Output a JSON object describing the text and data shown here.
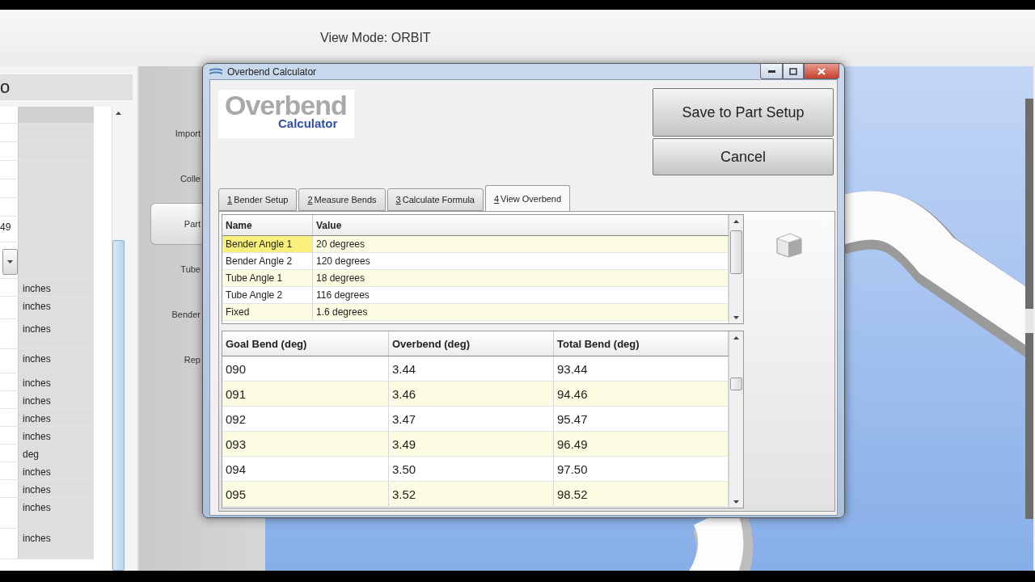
{
  "toolbar": {
    "view_mode": "View Mode: ORBIT"
  },
  "left_panel": {
    "title": "o",
    "rows": [
      {
        "kind": "text"
      },
      {
        "kind": "text"
      },
      {
        "kind": "text"
      },
      {
        "kind": "text"
      },
      {
        "kind": "text"
      },
      {
        "kind": "text",
        "value": "49"
      },
      {
        "kind": "dropdown"
      },
      {
        "kind": "text",
        "unit": "inches"
      },
      {
        "kind": "text",
        "unit": "inches"
      },
      {
        "kind": "text",
        "unit": "inches"
      },
      {
        "kind": "text",
        "unit": "inches"
      },
      {
        "kind": "text",
        "unit": "inches"
      },
      {
        "kind": "text",
        "unit": "inches"
      },
      {
        "kind": "text",
        "unit": "inches"
      },
      {
        "kind": "text",
        "unit": "inches"
      },
      {
        "kind": "text",
        "unit": "deg"
      },
      {
        "kind": "text",
        "unit": "inches"
      },
      {
        "kind": "text",
        "unit": "inches"
      },
      {
        "kind": "text",
        "unit": "inches"
      },
      {
        "kind": "text",
        "unit": "inches"
      }
    ]
  },
  "nav": [
    {
      "label": "Import",
      "selected": false
    },
    {
      "label": "Colle",
      "selected": false
    },
    {
      "label": "Part",
      "selected": true
    },
    {
      "label": "Tube",
      "selected": false
    },
    {
      "label": "Bender",
      "selected": false
    },
    {
      "label": "Rep",
      "selected": false
    }
  ],
  "dialog": {
    "title": "Overbend Calculator",
    "logo": {
      "title": "Overbend",
      "subtitle": "Calculator"
    },
    "buttons": [
      "Save to Part Setup",
      "Cancel"
    ],
    "tabs": [
      {
        "key": "1",
        "label": "Bender Setup",
        "selected": false
      },
      {
        "key": "2",
        "label": "Measure Bends",
        "selected": false
      },
      {
        "key": "3",
        "label": "Calculate Formula",
        "selected": false
      },
      {
        "key": "4",
        "label": "View Overbend",
        "selected": true
      }
    ],
    "settings_table": {
      "columns": [
        "Name",
        "Value"
      ],
      "rows": [
        {
          "name": "Bender Angle 1",
          "value": "20 degrees",
          "selected": true
        },
        {
          "name": "Bender Angle 2",
          "value": "120 degrees",
          "selected": false
        },
        {
          "name": "Tube Angle 1",
          "value": "18 degrees",
          "selected": false
        },
        {
          "name": "Tube Angle 2",
          "value": "116 degrees",
          "selected": false
        },
        {
          "name": "Fixed",
          "value": "1.6 degrees",
          "selected": false
        }
      ]
    },
    "overbend_table": {
      "columns": [
        "Goal Bend (deg)",
        "Overbend (deg)",
        "Total Bend (deg)"
      ],
      "rows": [
        [
          "090",
          "3.44",
          "93.44"
        ],
        [
          "091",
          "3.46",
          "94.46"
        ],
        [
          "092",
          "3.47",
          "95.47"
        ],
        [
          "093",
          "3.49",
          "96.49"
        ],
        [
          "094",
          "3.50",
          "97.50"
        ],
        [
          "095",
          "3.52",
          "98.52"
        ]
      ]
    }
  }
}
